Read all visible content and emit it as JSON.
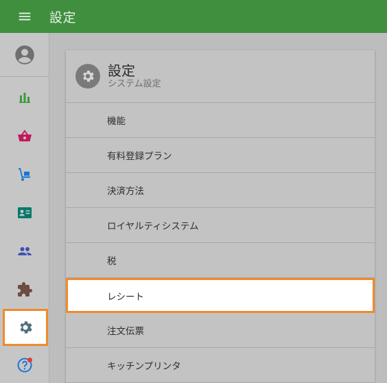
{
  "header": {
    "menu_icon": "menu-icon",
    "title": "設定"
  },
  "sidebar": {
    "avatar_icon": "account-circle-icon",
    "items": [
      {
        "name": "analytics",
        "icon": "bar-chart-icon",
        "color": "#3f9a3f"
      },
      {
        "name": "sales",
        "icon": "basket-icon",
        "color": "#c2185b"
      },
      {
        "name": "inventory",
        "icon": "hand-truck-icon",
        "color": "#1976d2"
      },
      {
        "name": "customers",
        "icon": "id-card-icon",
        "color": "#00796b"
      },
      {
        "name": "staff",
        "icon": "people-icon",
        "color": "#3f51b5"
      },
      {
        "name": "extensions",
        "icon": "puzzle-icon",
        "color": "#6d4c41"
      },
      {
        "name": "settings",
        "icon": "gear-icon",
        "color": "#546e7a",
        "active": true
      },
      {
        "name": "help",
        "icon": "help-circle-icon",
        "color": "#1976d2",
        "badge_color": "#e53935"
      }
    ]
  },
  "settings_card": {
    "icon": "gear-icon",
    "title": "設定",
    "subtitle": "システム設定",
    "items": [
      {
        "label": "機能"
      },
      {
        "label": "有料登録プラン"
      },
      {
        "label": "決済方法"
      },
      {
        "label": "ロイヤルティシステム"
      },
      {
        "label": "税"
      },
      {
        "label": "レシート",
        "selected": true
      },
      {
        "label": "注文伝票"
      },
      {
        "label": "キッチンプリンタ"
      }
    ]
  },
  "colors": {
    "primary": "#3f8f3f",
    "highlight": "#f08a2a"
  }
}
